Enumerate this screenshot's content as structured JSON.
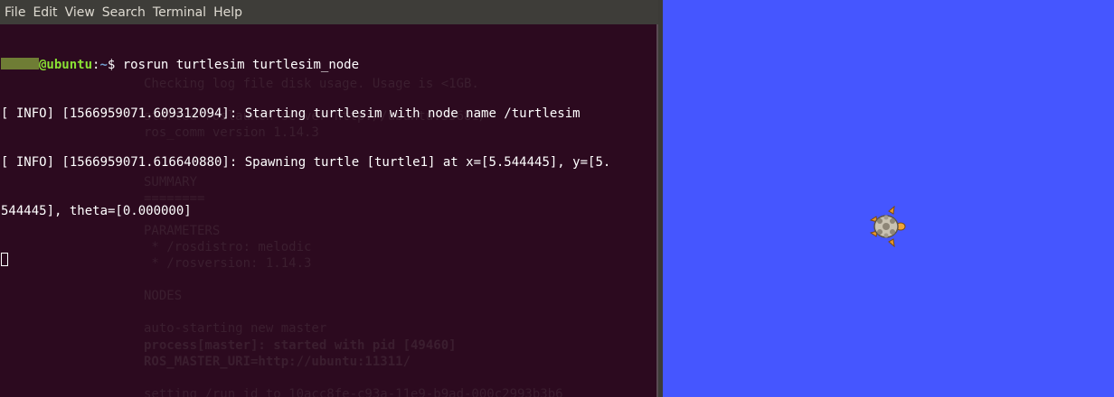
{
  "terminal": {
    "menu": [
      "File",
      "Edit",
      "View",
      "Search",
      "Terminal",
      "Help"
    ],
    "prompt": {
      "host": "@ubuntu",
      "sep": ":",
      "path": "~",
      "symbol": "$ ",
      "command": "rosrun turtlesim turtlesim_node"
    },
    "output": [
      "[ INFO] [1566959071.609312094]: Starting turtlesim with node name /turtlesim",
      "[ INFO] [1566959071.616640880]: Spawning turtle [turtle1] at x=[5.544445], y=[5.",
      "544445], theta=[0.000000]"
    ],
    "background_text": [
      "Checking log file disk usage. Usage is <1GB.",
      "",
      "started roslaunch server http://ubuntu:35681/",
      "ros_comm version 1.14.3",
      "",
      "",
      "SUMMARY",
      "========",
      "",
      "PARAMETERS",
      " * /rosdistro: melodic",
      " * /rosversion: 1.14.3",
      "",
      "NODES",
      "",
      "auto-starting new master",
      "process[master]: started with pid [49460]",
      "ROS_MASTER_URI=http://ubuntu:11311/",
      "",
      "setting /run_id to 10acc8fe-c93a-11e9-b9ad-000c2993b3b6"
    ]
  },
  "turtlesim": {
    "background_color": "#4556ff",
    "turtle_icon": "turtle-icon",
    "turtle_heading_deg": 0
  }
}
